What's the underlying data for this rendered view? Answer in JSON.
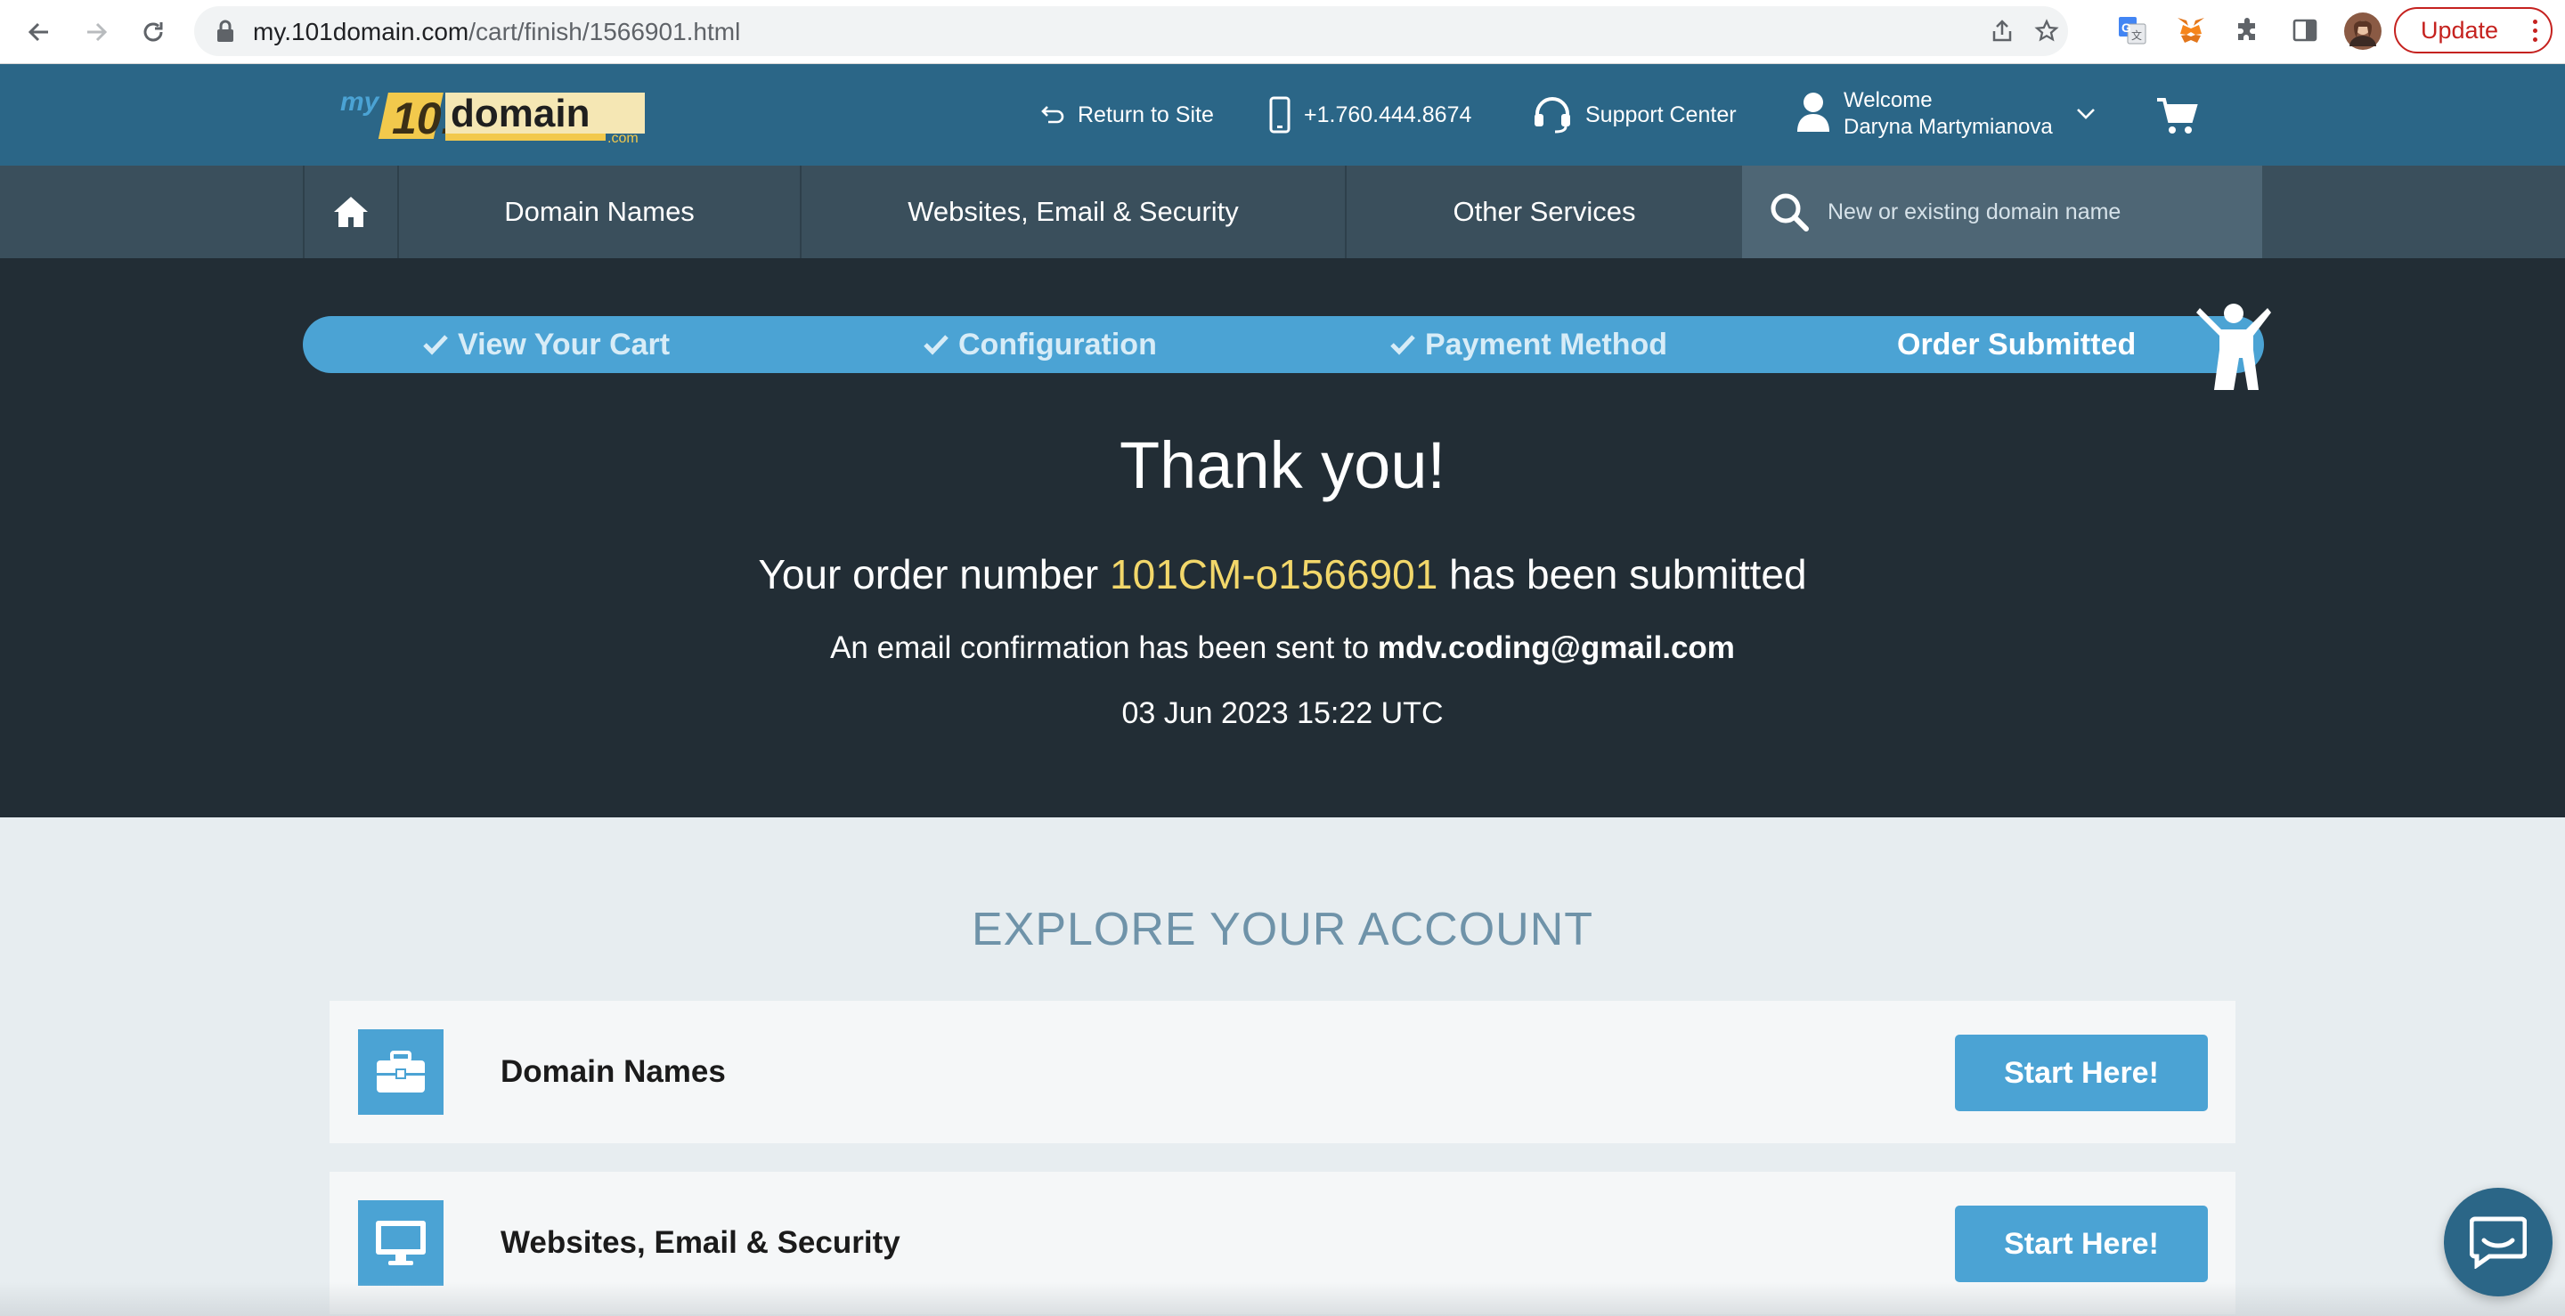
{
  "browser": {
    "url_host": "my.101domain.com",
    "url_path": "/cart/finish/1566901.html",
    "update_label": "Update",
    "icons": [
      "back-icon",
      "forward-icon",
      "reload-icon",
      "lock-icon",
      "share-icon",
      "star-icon",
      "translate-icon",
      "metamask-icon",
      "extensions-icon",
      "sidepanel-icon",
      "profile-avatar",
      "menu-dots-icon"
    ]
  },
  "header": {
    "logo_text_my": "my",
    "logo_text_101": "101",
    "logo_text_domain": "domain",
    "logo_text_com": ".com",
    "return_label": "Return to Site",
    "phone": "+1.760.444.8674",
    "support_label": "Support Center",
    "welcome_label": "Welcome",
    "user_name": "Daryna Martymianova"
  },
  "nav": {
    "items": [
      "Domain Names",
      "Websites, Email & Security",
      "Other Services"
    ],
    "search_placeholder": "New or existing domain name"
  },
  "steps": [
    {
      "label": "View Your Cart",
      "done": true
    },
    {
      "label": "Configuration",
      "done": true
    },
    {
      "label": "Payment Method",
      "done": true
    },
    {
      "label": "Order Submitted",
      "done": false
    }
  ],
  "confirmation": {
    "title": "Thank you!",
    "order_prefix": "Your order number",
    "order_number": "101CM-o1566901",
    "order_suffix": "has been submitted",
    "email_prefix": "An email confirmation has been sent to",
    "email": "mdv.coding@gmail.com",
    "datetime": "03 Jun 2023 15:22 UTC"
  },
  "explore": {
    "title": "EXPLORE YOUR ACCOUNT",
    "cards": [
      {
        "title": "Domain Names",
        "button": "Start Here!",
        "icon": "briefcase-icon"
      },
      {
        "title": "Websites, Email & Security",
        "button": "Start Here!",
        "icon": "monitor-icon"
      }
    ]
  },
  "colors": {
    "topbar": "#2b6687",
    "navbar": "#3a4f5c",
    "hero": "#222d35",
    "accent": "#4ba3d4",
    "order_number": "#f2d76a"
  }
}
